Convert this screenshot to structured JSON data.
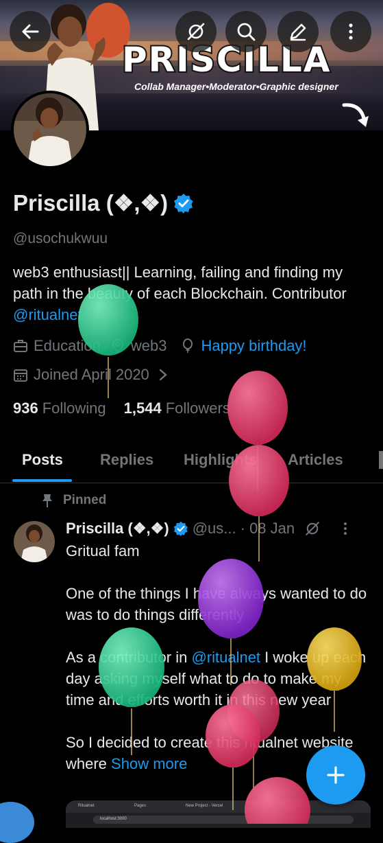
{
  "banner": {
    "title": "PRISCILLA",
    "subtitle": "Collab Manager•Moderator•Graphic designer"
  },
  "profile": {
    "name": "Priscilla (❖,❖)",
    "handle": "@usochukwuu",
    "bio_text_1": "web3 enthusiast|| Learning, failing and finding my path in the beauty of each Blockchain. Contributor ",
    "bio_link": "@ritualnet",
    "category": "Education",
    "location": "web3",
    "birthday_link": "Happy birthday!",
    "joined": "Joined April 2020",
    "following_count": "936",
    "following_label": "Following",
    "followers_count": "1,544",
    "followers_label": "Followers"
  },
  "tabs": [
    "Posts",
    "Replies",
    "Highlights",
    "Articles"
  ],
  "pinned_label": "Pinned",
  "tweet": {
    "name": "Priscilla (❖,❖)",
    "handle": "@us...",
    "date": "· 08 Jan",
    "para1": "Gritual fam",
    "para2": "One of the things I have always wanted to do was to do things differently",
    "para3_before": "As a contributor in ",
    "para3_link": "@ritualnet",
    "para3_after": " I woke up each day asking myself what to do to make my time and efforts worth it in this new year",
    "para4": "So I decided to create this ritualnet website where ",
    "show_more": "Show more"
  },
  "screenshot_preview": {
    "tab1": "Ritualnet",
    "tab2": "Pages",
    "tab3": "New Project - Vercel",
    "url": "localhost:3000"
  },
  "colors": {
    "accent": "#1d9bf0",
    "background": "#000000",
    "muted": "#71767b",
    "balloon_green": "#2ecc8f",
    "balloon_red": "#e63e6d",
    "balloon_purple": "#9b3fe0",
    "balloon_yellow": "#e2b718"
  },
  "icons": [
    "back-arrow-icon",
    "grok-icon",
    "search-icon",
    "edit-icon",
    "more-icon",
    "verified-icon",
    "briefcase-icon",
    "location-icon",
    "balloon-icon",
    "calendar-icon",
    "chevron-right-icon",
    "pin-icon",
    "plus-icon"
  ]
}
